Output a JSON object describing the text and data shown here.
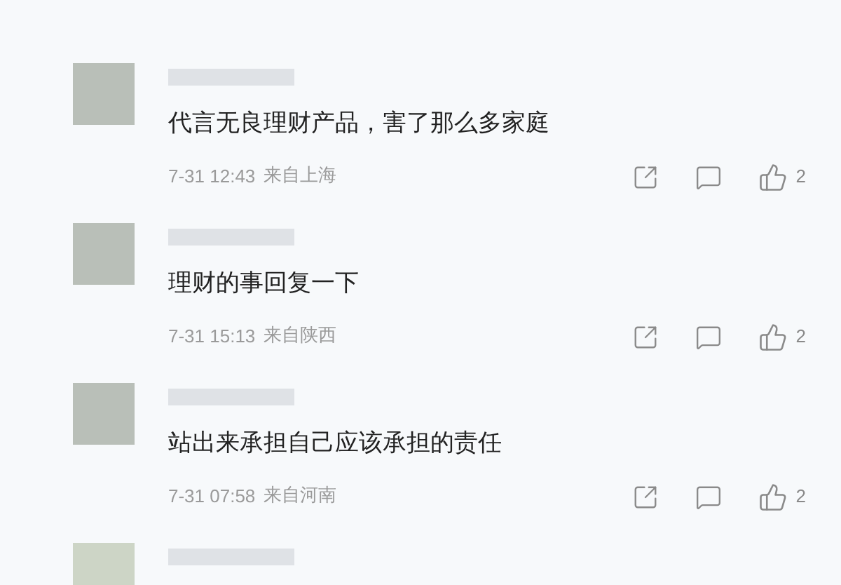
{
  "comments": [
    {
      "text": "代言无良理财产品，害了那么多家庭",
      "time": "7-31 12:43",
      "location": "来自上海",
      "likes": "2"
    },
    {
      "text": "理财的事回复一下",
      "time": "7-31 15:13",
      "location": "来自陕西",
      "likes": "2"
    },
    {
      "text": "站出来承担自己应该承担的责任",
      "time": "7-31 07:58",
      "location": "来自河南",
      "likes": "2"
    }
  ]
}
